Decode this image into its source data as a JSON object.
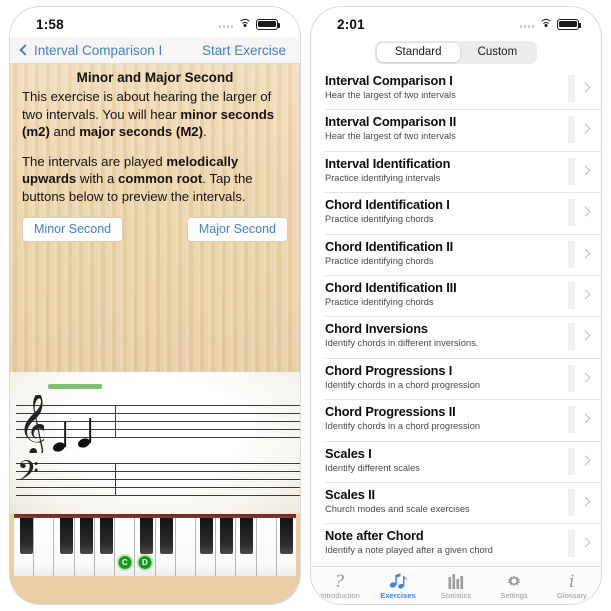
{
  "left_phone": {
    "status_bar": {
      "time": "1:58",
      "signal_icon": "cellular-dots-icon",
      "wifi_icon": "wifi-icon",
      "battery_icon": "battery-full-icon"
    },
    "nav": {
      "back_label": "Interval Comparison I",
      "back_icon": "chevron-left-icon",
      "action_label": "Start Exercise"
    },
    "exercise": {
      "title": "Minor and Major Second",
      "paragraph1_parts": [
        "This exercise is about hearing the larger of two intervals. You will hear ",
        "minor seconds (m2)",
        " and ",
        "major seconds (M2)",
        "."
      ],
      "paragraph2_parts": [
        "The intervals are played ",
        "melodically upwards",
        " with a ",
        "common root",
        ". Tap the buttons below to preview the intervals."
      ],
      "preview_buttons": [
        "Minor Second",
        "Major Second"
      ]
    },
    "staff": {
      "treble_clef_icon": "treble-clef-icon",
      "bass_clef_icon": "bass-clef-icon",
      "progress_bar_color": "#7cc36c",
      "notes": [
        "C",
        "D"
      ]
    },
    "keyboard": {
      "highlighted_keys": [
        "C",
        "D"
      ],
      "highlight_color": "#15991c"
    }
  },
  "right_phone": {
    "status_bar": {
      "time": "2:01",
      "signal_icon": "cellular-dots-icon",
      "wifi_icon": "wifi-icon",
      "battery_icon": "battery-full-icon"
    },
    "segmented_control": {
      "options": [
        "Standard",
        "Custom"
      ],
      "selected": "Standard"
    },
    "exercise_list": [
      {
        "title": "Interval Comparison I",
        "subtitle": "Hear the largest of two intervals"
      },
      {
        "title": "Interval Comparison II",
        "subtitle": "Hear the largest of two intervals"
      },
      {
        "title": "Interval Identification",
        "subtitle": "Practice identifying intervals"
      },
      {
        "title": "Chord Identification I",
        "subtitle": "Practice identifying chords"
      },
      {
        "title": "Chord Identification II",
        "subtitle": "Practice identifying chords"
      },
      {
        "title": "Chord Identification III",
        "subtitle": "Practice identifying chords"
      },
      {
        "title": "Chord Inversions",
        "subtitle": "Identify chords in different inversions."
      },
      {
        "title": "Chord Progressions I",
        "subtitle": "Identify chords in a chord progression"
      },
      {
        "title": "Chord Progressions II",
        "subtitle": "Identify chords in a chord progression"
      },
      {
        "title": "Scales I",
        "subtitle": "Identify different scales"
      },
      {
        "title": "Scales II",
        "subtitle": "Church modes and scale exercises"
      },
      {
        "title": "Note after Chord",
        "subtitle": "Identify a note played after a given chord"
      }
    ],
    "tab_bar": {
      "active": "Exercises",
      "accent_color": "#3d87e8",
      "tabs": [
        {
          "label": "Introduction",
          "icon": "question-mark-icon"
        },
        {
          "label": "Exercises",
          "icon": "music-notes-icon"
        },
        {
          "label": "Statistics",
          "icon": "bar-chart-icon"
        },
        {
          "label": "Settings",
          "icon": "gear-icon"
        },
        {
          "label": "Glossary",
          "icon": "italic-i-icon"
        }
      ]
    }
  }
}
